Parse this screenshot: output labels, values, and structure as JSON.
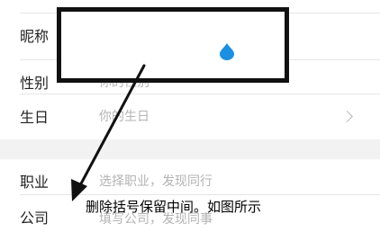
{
  "profile": {
    "nickname_label": "昵称",
    "gender_label": "性别",
    "gender_placeholder": "你的性别",
    "birthday_label": "生日",
    "birthday_placeholder": "你的生日",
    "job_label": "职业",
    "job_placeholder": "选择职业，发现同行",
    "company_label": "公司",
    "company_placeholder": "填写公司，发现同事"
  },
  "annotation": {
    "caption": "删除括号保留中间。如图所示",
    "box_color": "#111111",
    "arrow_color": "#111111"
  },
  "colors": {
    "cursor_drop": "#1a8fe3",
    "section_gap": "#f2f2f2",
    "placeholder_text": "#b3b3b3"
  }
}
